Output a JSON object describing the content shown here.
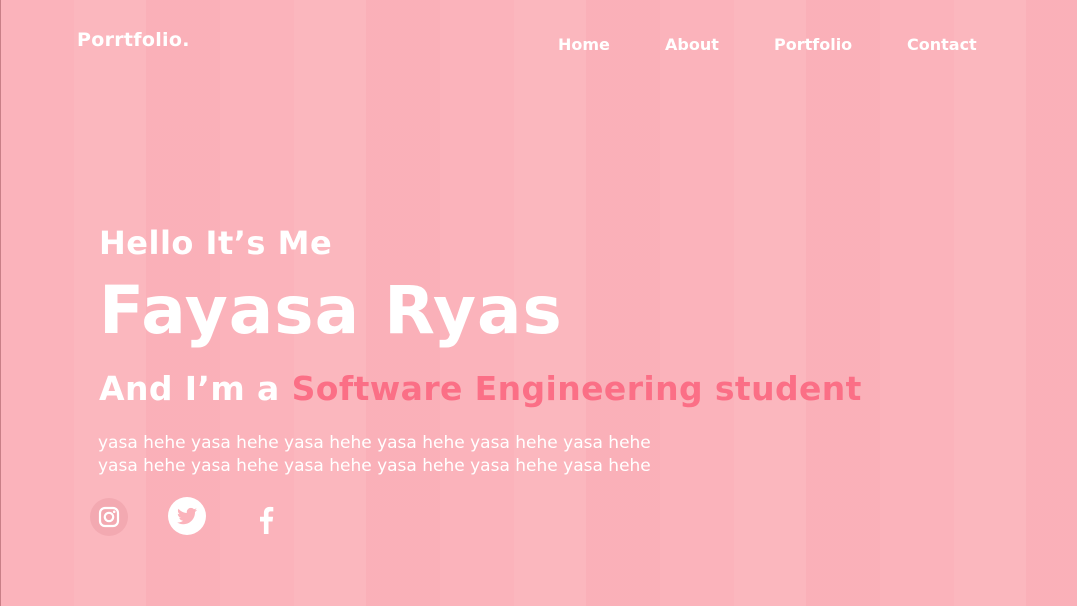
{
  "brand": {
    "logo": "Porrtfolio."
  },
  "nav": {
    "items": [
      {
        "label": "Home"
      },
      {
        "label": "About"
      },
      {
        "label": "Portfolio"
      },
      {
        "label": "Contact"
      }
    ]
  },
  "hero": {
    "greeting": "Hello It’s Me",
    "name": "Fayasa Ryas",
    "role_prefix": "And I’m a ",
    "role_highlight": "Software Engineering student",
    "bio": "yasa hehe yasa hehe yasa hehe yasa hehe yasa hehe yasa hehe\nyasa hehe yasa hehe yasa hehe yasa hehe yasa hehe yasa hehe"
  },
  "social": {
    "icons": [
      "instagram-icon",
      "twitter-icon",
      "facebook-icon"
    ]
  },
  "colors": {
    "background": "#fbb3bb",
    "accent": "#fb6f86",
    "text": "#ffffff"
  }
}
